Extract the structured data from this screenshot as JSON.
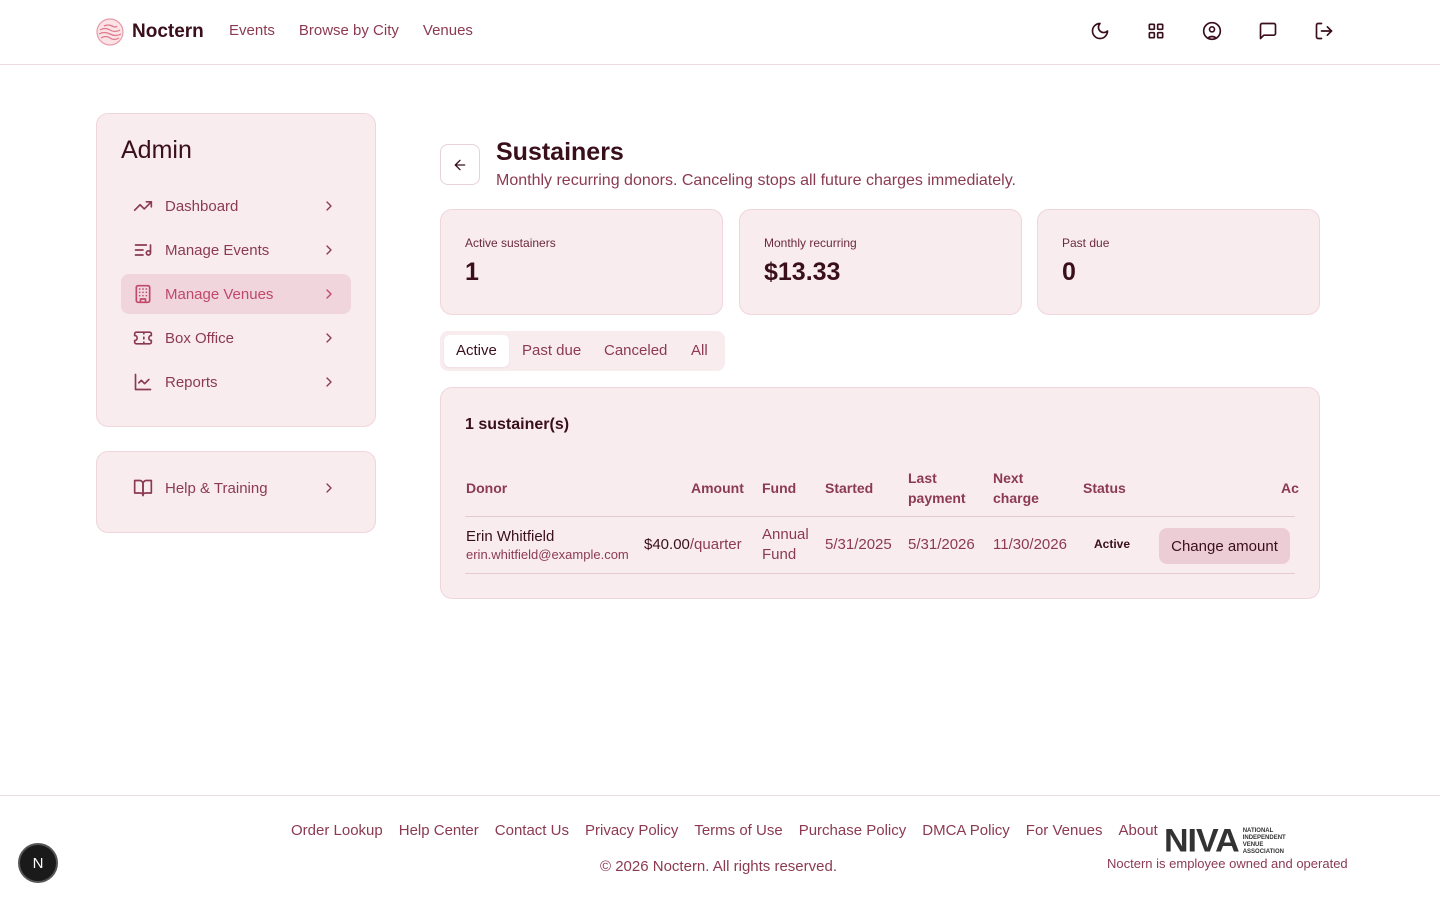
{
  "header": {
    "brand": "Noctern",
    "nav": [
      "Events",
      "Browse by City",
      "Venues"
    ],
    "icons": [
      "moon-icon",
      "grid-icon",
      "user-circle-icon",
      "message-icon",
      "logout-icon"
    ]
  },
  "sidebar": {
    "title": "Admin",
    "items": [
      {
        "label": "Dashboard",
        "icon": "trending-up-icon"
      },
      {
        "label": "Manage Events",
        "icon": "list-music-icon"
      },
      {
        "label": "Manage Venues",
        "icon": "building-icon",
        "active": true
      },
      {
        "label": "Box Office",
        "icon": "ticket-icon"
      },
      {
        "label": "Reports",
        "icon": "line-chart-icon"
      }
    ],
    "help": {
      "label": "Help & Training",
      "icon": "book-open-icon"
    }
  },
  "page": {
    "title": "Sustainers",
    "subtitle": "Monthly recurring donors. Canceling stops all future charges immediately."
  },
  "stats": [
    {
      "label": "Active sustainers",
      "value": "1"
    },
    {
      "label": "Monthly recurring",
      "value": "$13.33"
    },
    {
      "label": "Past due",
      "value": "0"
    }
  ],
  "tabs": [
    {
      "label": "Active",
      "active": true
    },
    {
      "label": "Past due"
    },
    {
      "label": "Canceled"
    },
    {
      "label": "All"
    }
  ],
  "table": {
    "count": "1 sustainer(s)",
    "headers": {
      "donor": "Donor",
      "amount": "Amount",
      "fund": "Fund",
      "started": "Started",
      "last_payment": "Last payment",
      "next_charge": "Next charge",
      "status": "Status",
      "actions": "Ac"
    },
    "rows": [
      {
        "name": "Erin Whitfield",
        "email": "erin.whitfield@example.com",
        "amount": "$40.00",
        "period": "/quarter",
        "fund": "Annual Fund",
        "started": "5/31/2025",
        "last_payment": "5/31/2026",
        "next_charge": "11/30/2026",
        "status": "Active",
        "action": "Change amount"
      }
    ]
  },
  "footer": {
    "links": [
      "Order Lookup",
      "Help Center",
      "Contact Us",
      "Privacy Policy",
      "Terms of Use",
      "Purchase Policy",
      "DMCA Policy",
      "For Venues",
      "About"
    ],
    "copyright": "© 2026 Noctern. All rights reserved.",
    "niva_logo": "NIVA",
    "niva_small": "NATIONAL INDEPENDENT VENUE ASSOCIATION",
    "tagline": "Noctern is employee owned and operated"
  },
  "dev_badge": "N",
  "colors": {
    "accent": "#c0486a",
    "text_primary": "#3a0f1c",
    "text_secondary": "#8b3a52",
    "card_bg": "#f9ecef"
  }
}
